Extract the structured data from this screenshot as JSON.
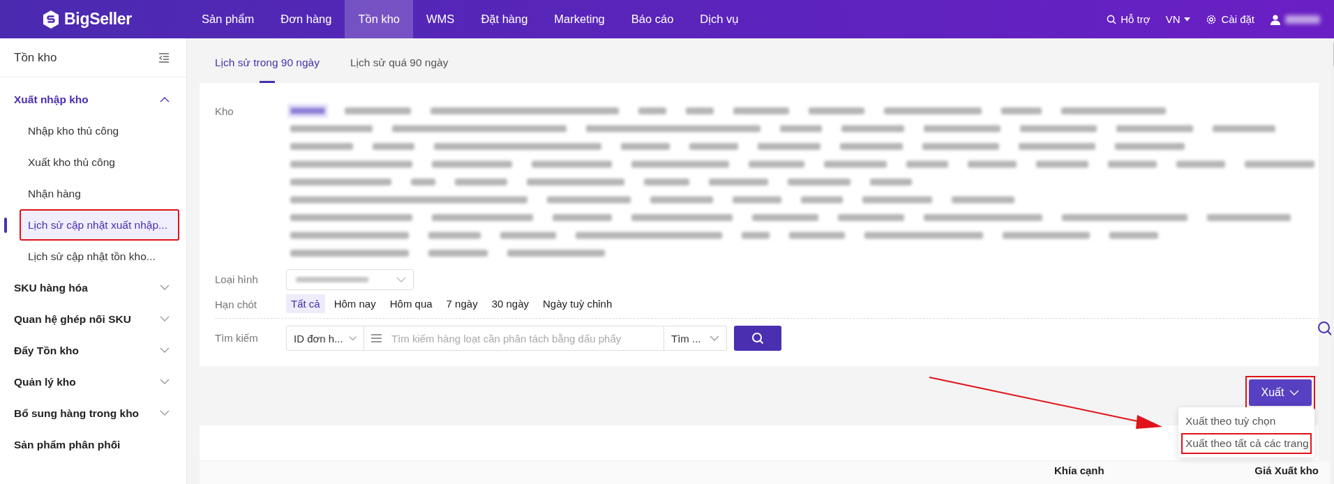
{
  "logo": {
    "text": "BigSeller"
  },
  "nav": [
    {
      "label": "Sản phẩm",
      "selected": false
    },
    {
      "label": "Đơn hàng",
      "selected": false
    },
    {
      "label": "Tồn kho",
      "selected": true
    },
    {
      "label": "WMS",
      "selected": false
    },
    {
      "label": "Đặt hàng",
      "selected": false
    },
    {
      "label": "Marketing",
      "selected": false
    },
    {
      "label": "Báo cáo",
      "selected": false
    },
    {
      "label": "Dịch vụ",
      "selected": false
    }
  ],
  "top_right": {
    "help": "Hỗ trợ",
    "language": "VN",
    "settings": "Cài đặt",
    "user_blurred": true
  },
  "sidebar": {
    "title": "Tồn kho",
    "groups": [
      {
        "kind": "group",
        "label": "Xuất nhập kho",
        "expanded": true,
        "children": [
          {
            "label": "Nhập kho thủ công",
            "selected": false,
            "highlighted": false
          },
          {
            "label": "Xuất kho thủ công",
            "selected": false,
            "highlighted": false
          },
          {
            "label": "Nhận hàng",
            "selected": false,
            "highlighted": false
          },
          {
            "label": "Lịch sử cập nhật xuất nhập...",
            "selected": true,
            "highlighted": true
          },
          {
            "label": "Lịch sử cập nhật tồn kho...",
            "selected": false,
            "highlighted": false
          }
        ]
      },
      {
        "kind": "group",
        "label": "SKU hàng hóa",
        "expanded": false
      },
      {
        "kind": "group",
        "label": "Quan hệ ghép nối SKU",
        "expanded": false
      },
      {
        "kind": "group",
        "label": "Đẩy Tồn kho",
        "expanded": false
      },
      {
        "kind": "group",
        "label": "Quản lý kho",
        "expanded": false
      },
      {
        "kind": "group",
        "label": "Bổ sung hàng trong kho",
        "expanded": false
      },
      {
        "kind": "link",
        "label": "Sản phẩm phân phối"
      }
    ]
  },
  "tabs": [
    {
      "label": "Lịch sử trong 90 ngày",
      "selected": true
    },
    {
      "label": "Lịch sử quá 90 ngày",
      "selected": false
    }
  ],
  "filters": {
    "warehouse": {
      "label": "Kho",
      "values_blurred": true
    },
    "type": {
      "label": "Loại hình",
      "value_blurred": true
    },
    "deadline": {
      "label": "Hạn chót",
      "options": [
        {
          "label": "Tất cả",
          "selected": true
        },
        {
          "label": "Hôm nay",
          "selected": false
        },
        {
          "label": "Hôm qua",
          "selected": false
        },
        {
          "label": "7 ngày",
          "selected": false
        },
        {
          "label": "30 ngày",
          "selected": false
        },
        {
          "label": "Ngày tuỳ chỉnh",
          "selected": false
        }
      ]
    },
    "search": {
      "label": "Tìm kiếm",
      "field_select": "ID đơn h...",
      "placeholder": "Tìm kiếm hàng loạt cần phân tách bằng dấu phẩy",
      "mode_select": "Tìm ..."
    }
  },
  "export": {
    "label": "Xuất",
    "expanded": true,
    "highlighted": true,
    "menu": [
      {
        "label": "Xuất theo tuỳ chọn",
        "highlighted": false
      },
      {
        "label": "Xuất theo tất cả các trang",
        "highlighted": true
      }
    ]
  },
  "annotation_arrow": true,
  "table": {
    "columns": [
      {
        "label": "Khía cạnh"
      },
      {
        "label": "Giá Xuất kho"
      }
    ]
  }
}
